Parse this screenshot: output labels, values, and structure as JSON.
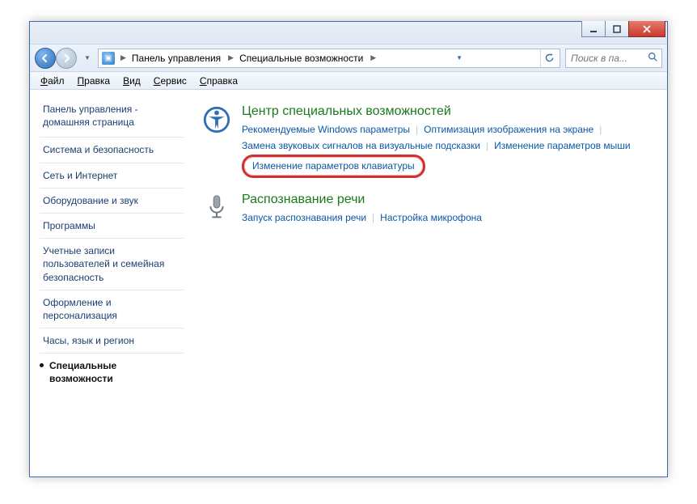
{
  "titlebar": {
    "minimize_tip": "Свернуть",
    "maximize_tip": "Развернуть",
    "close_tip": "Закрыть"
  },
  "addr": {
    "root_tip": "Компьютер",
    "seg1": "Панель управления",
    "seg2": "Специальные возможности"
  },
  "search": {
    "placeholder": "Поиск в па..."
  },
  "menubar": {
    "file": "Файл",
    "edit": "Правка",
    "view": "Вид",
    "tools": "Сервис",
    "help": "Справка"
  },
  "sidebar": {
    "home": "Панель управления - домашняя страница",
    "items": [
      "Система и безопасность",
      "Сеть и Интернет",
      "Оборудование и звук",
      "Программы",
      "Учетные записи пользователей и семейная безопасность",
      "Оформление и персонализация",
      "Часы, язык и регион",
      "Специальные возможности"
    ],
    "active_index": 7
  },
  "content": {
    "cat1": {
      "title": "Центр специальных возможностей",
      "links": [
        "Рекомендуемые Windows параметры",
        "Оптимизация изображения на экране",
        "Замена звуковых сигналов на визуальные подсказки",
        "Изменение параметров мыши",
        "Изменение параметров клавиатуры"
      ],
      "highlight_index": 4
    },
    "cat2": {
      "title": "Распознавание речи",
      "links": [
        "Запуск распознавания речи",
        "Настройка микрофона"
      ]
    }
  }
}
